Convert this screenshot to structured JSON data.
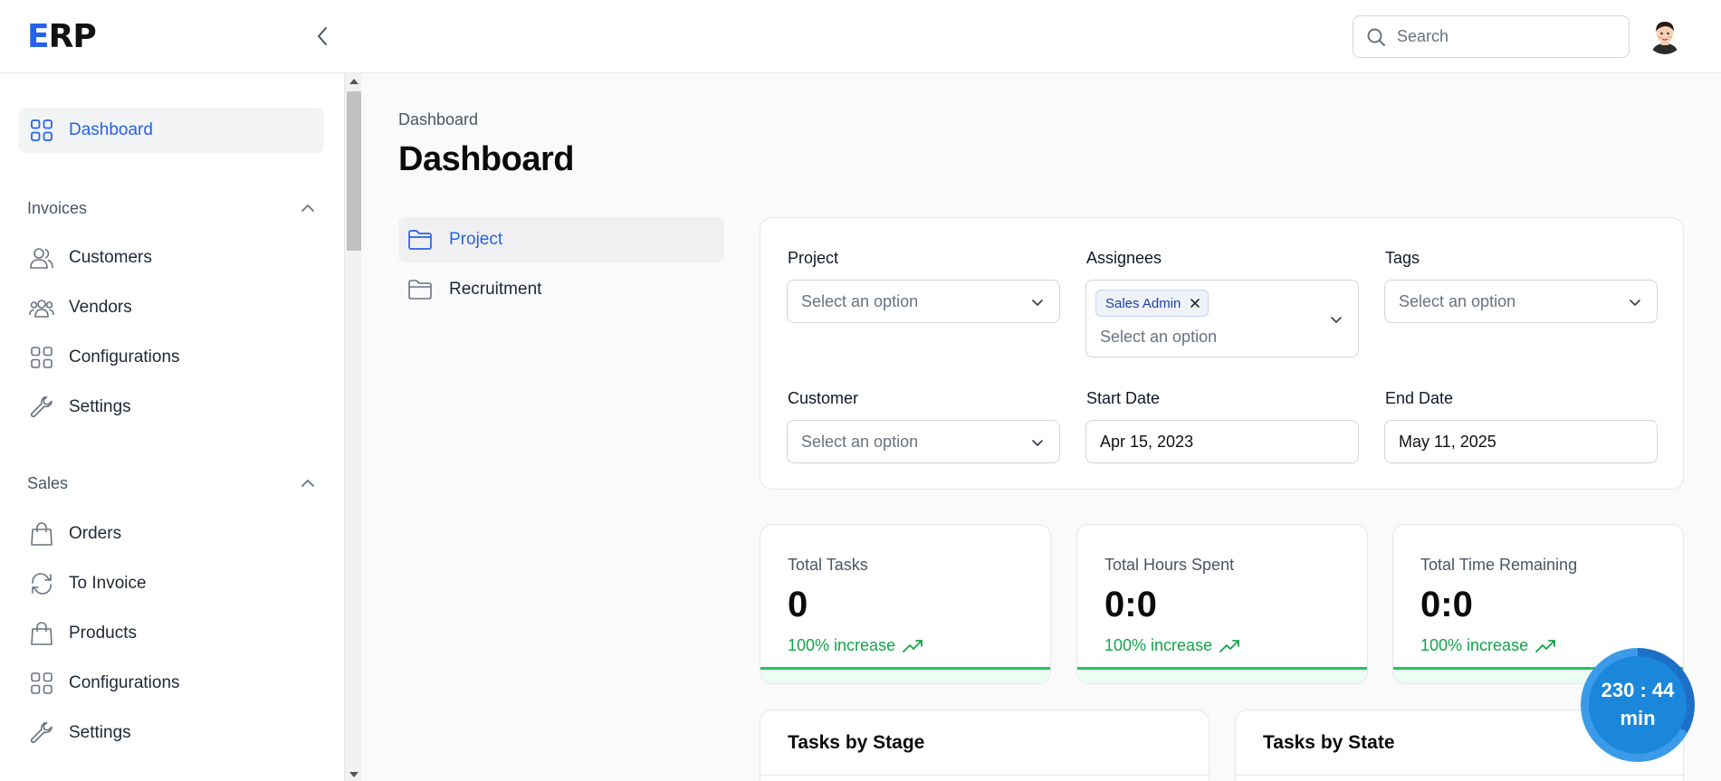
{
  "app": {
    "logo_first": "E",
    "logo_rest": "RP"
  },
  "header": {
    "search_placeholder": "Search"
  },
  "sidebar": {
    "dashboard": "Dashboard",
    "groups": [
      {
        "label": "Invoices",
        "items": [
          "Customers",
          "Vendors",
          "Configurations",
          "Settings"
        ]
      },
      {
        "label": "Sales",
        "items": [
          "Orders",
          "To Invoice",
          "Products",
          "Configurations",
          "Settings"
        ]
      }
    ]
  },
  "main": {
    "breadcrumb": "Dashboard",
    "title": "Dashboard",
    "sub_nav": [
      "Project",
      "Recruitment"
    ],
    "filters": {
      "project_label": "Project",
      "project_placeholder": "Select an option",
      "assignees_label": "Assignees",
      "assignees_chip": "Sales Admin",
      "assignees_placeholder": "Select an option",
      "tags_label": "Tags",
      "tags_placeholder": "Select an option",
      "customer_label": "Customer",
      "customer_placeholder": "Select an option",
      "start_label": "Start Date",
      "start_value": "Apr 15, 2023",
      "end_label": "End Date",
      "end_value": "May 11, 2025"
    },
    "stats": [
      {
        "label": "Total Tasks",
        "value": "0",
        "change": "100% increase",
        "progress": 1.0
      },
      {
        "label": "Total Hours Spent",
        "value": "0:0",
        "change": "100% increase",
        "progress": 1.0
      },
      {
        "label": "Total Time Remaining",
        "value": "0:0",
        "change": "100% increase",
        "progress": 1.0
      }
    ],
    "charts": [
      "Tasks by Stage",
      "Tasks by State"
    ]
  },
  "timer": {
    "line1": "230 : 44",
    "line2": "min",
    "progress": 0.33
  },
  "colors": {
    "accent": "#2563eb",
    "success": "#16a34a",
    "timer": "#1a87db"
  }
}
